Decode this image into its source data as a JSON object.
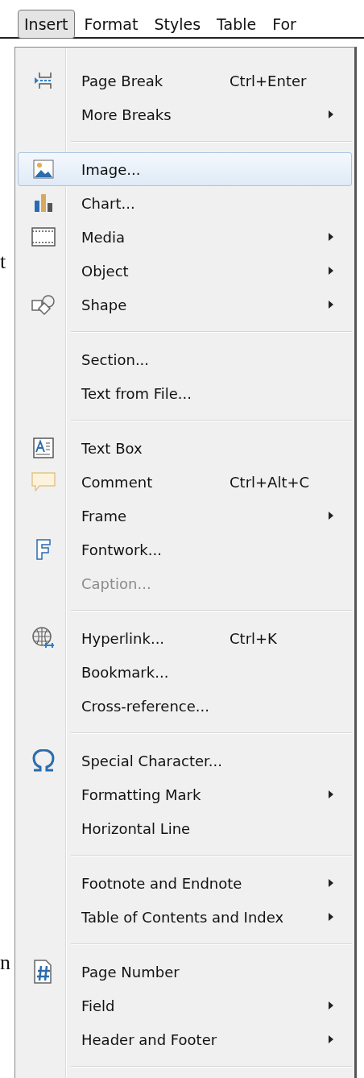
{
  "menubar": [
    {
      "label": "Insert",
      "selected": true
    },
    {
      "label": "Format",
      "selected": false
    },
    {
      "label": "Styles",
      "selected": false
    },
    {
      "label": "Table",
      "selected": false
    },
    {
      "label": "For",
      "selected": false
    }
  ],
  "document_fragments": [
    "t",
    "n"
  ],
  "menu": {
    "groups": [
      [
        {
          "label": "Page Break",
          "shortcut": "Ctrl+Enter",
          "kind": "pagebreak",
          "submenu": false,
          "disabled": false,
          "selected": false
        },
        {
          "label": "More Breaks",
          "submenu": true,
          "disabled": false,
          "selected": false
        }
      ],
      [
        {
          "label": "Image...",
          "kind": "image",
          "submenu": false,
          "disabled": false,
          "selected": true
        },
        {
          "label": "Chart...",
          "kind": "chart",
          "submenu": false,
          "disabled": false,
          "selected": false
        },
        {
          "label": "Media",
          "kind": "media",
          "submenu": true,
          "disabled": false,
          "selected": false
        },
        {
          "label": "Object",
          "submenu": true,
          "disabled": false,
          "selected": false
        },
        {
          "label": "Shape",
          "kind": "shape",
          "submenu": true,
          "disabled": false,
          "selected": false
        }
      ],
      [
        {
          "label": "Section...",
          "submenu": false,
          "disabled": false,
          "selected": false
        },
        {
          "label": "Text from File...",
          "submenu": false,
          "disabled": false,
          "selected": false
        }
      ],
      [
        {
          "label": "Text Box",
          "kind": "textbox",
          "submenu": false,
          "disabled": false,
          "selected": false
        },
        {
          "label": "Comment",
          "shortcut": "Ctrl+Alt+C",
          "kind": "comment",
          "submenu": false,
          "disabled": false,
          "selected": false
        },
        {
          "label": "Frame",
          "submenu": true,
          "disabled": false,
          "selected": false
        },
        {
          "label": "Fontwork...",
          "kind": "fontwork",
          "submenu": false,
          "disabled": false,
          "selected": false
        },
        {
          "label": "Caption...",
          "submenu": false,
          "disabled": true,
          "selected": false
        }
      ],
      [
        {
          "label": "Hyperlink...",
          "shortcut": "Ctrl+K",
          "kind": "hyperlink",
          "submenu": false,
          "disabled": false,
          "selected": false
        },
        {
          "label": "Bookmark...",
          "submenu": false,
          "disabled": false,
          "selected": false
        },
        {
          "label": "Cross-reference...",
          "submenu": false,
          "disabled": false,
          "selected": false
        }
      ],
      [
        {
          "label": "Special Character...",
          "kind": "symbol",
          "submenu": false,
          "disabled": false,
          "selected": false
        },
        {
          "label": "Formatting Mark",
          "submenu": true,
          "disabled": false,
          "selected": false
        },
        {
          "label": "Horizontal Line",
          "submenu": false,
          "disabled": false,
          "selected": false
        }
      ],
      [
        {
          "label": "Footnote and Endnote",
          "submenu": true,
          "disabled": false,
          "selected": false
        },
        {
          "label": "Table of Contents and Index",
          "submenu": true,
          "disabled": false,
          "selected": false
        }
      ],
      [
        {
          "label": "Page Number",
          "kind": "pagenumber",
          "submenu": false,
          "disabled": false,
          "selected": false
        },
        {
          "label": "Field",
          "submenu": true,
          "disabled": false,
          "selected": false
        },
        {
          "label": "Header and Footer",
          "submenu": true,
          "disabled": false,
          "selected": false
        }
      ]
    ]
  }
}
